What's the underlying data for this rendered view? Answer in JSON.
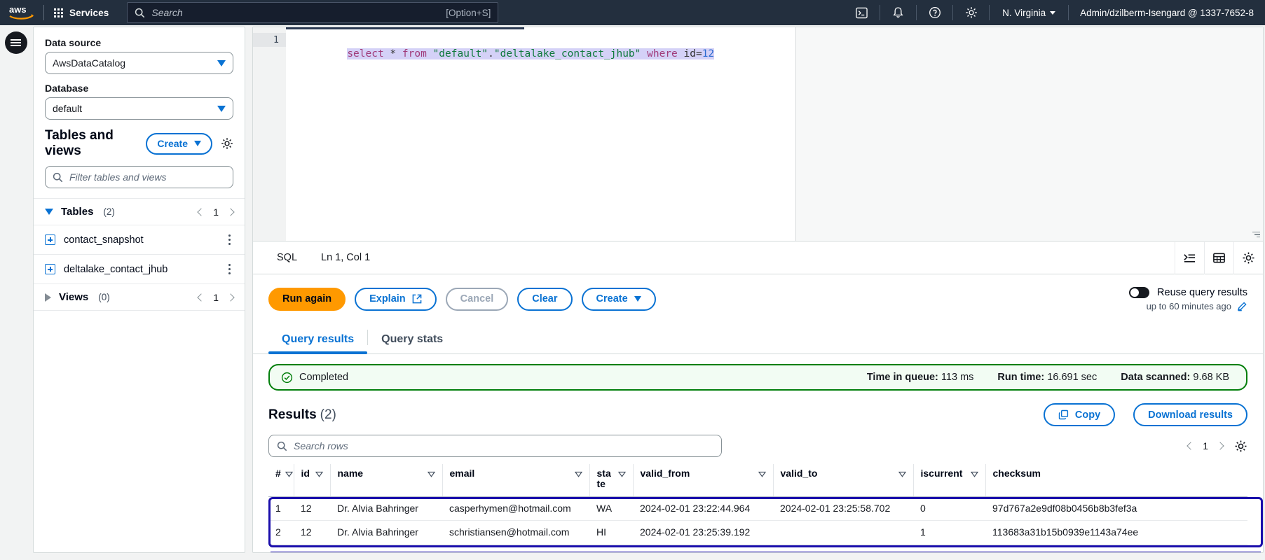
{
  "topnav": {
    "logo_alt": "aws",
    "services_label": "Services",
    "search_placeholder": "Search",
    "search_hint": "[Option+S]",
    "icons": [
      "cloudshell-icon",
      "notifications-icon",
      "help-icon",
      "settings-icon"
    ],
    "region": "N. Virginia",
    "account": "Admin/dzilberm-Isengard @ 1337-7652-8"
  },
  "sidebar": {
    "data_source_label": "Data source",
    "data_source_value": "AwsDataCatalog",
    "database_label": "Database",
    "database_value": "default",
    "tables_views_title": "Tables and views",
    "create_label": "Create",
    "filter_placeholder": "Filter tables and views",
    "groups": [
      {
        "name": "Tables",
        "count": "(2)",
        "page": "1",
        "expanded": true
      },
      {
        "name": "Views",
        "count": "(0)",
        "page": "1",
        "expanded": false
      }
    ],
    "tables": [
      {
        "name": "contact_snapshot"
      },
      {
        "name": "deltalake_contact_jhub"
      }
    ]
  },
  "editor": {
    "line_number": "1",
    "sql_tokens": [
      {
        "text": "select",
        "type": "kw"
      },
      {
        "text": " ",
        "type": "plain"
      },
      {
        "text": "*",
        "type": "op"
      },
      {
        "text": " ",
        "type": "plain"
      },
      {
        "text": "from",
        "type": "kw"
      },
      {
        "text": " ",
        "type": "plain"
      },
      {
        "text": "\"default\"",
        "type": "str"
      },
      {
        "text": ".",
        "type": "op"
      },
      {
        "text": "\"deltalake_contact_jhub\"",
        "type": "str"
      },
      {
        "text": " ",
        "type": "plain"
      },
      {
        "text": "where",
        "type": "kw"
      },
      {
        "text": " ",
        "type": "plain"
      },
      {
        "text": "id",
        "type": "op"
      },
      {
        "text": "=",
        "type": "op"
      },
      {
        "text": "12",
        "type": "num"
      }
    ],
    "sql_plain": "select * from \"default\".\"deltalake_contact_jhub\" where id=12"
  },
  "statusbar": {
    "language": "SQL",
    "cursor": "Ln 1, Col 1",
    "icons": [
      "format-sql-icon",
      "table-preferences-icon",
      "settings-gear-icon"
    ]
  },
  "actions": {
    "run_again": "Run again",
    "explain": "Explain",
    "cancel": "Cancel",
    "clear": "Clear",
    "create": "Create",
    "reuse_label": "Reuse query results",
    "reuse_sub": "up to 60 minutes ago",
    "reuse_enabled": false
  },
  "tabs": [
    {
      "label": "Query results",
      "active": true
    },
    {
      "label": "Query stats",
      "active": false
    }
  ],
  "banner": {
    "status": "Completed",
    "time_in_queue_label": "Time in queue:",
    "time_in_queue_value": "113 ms",
    "run_time_label": "Run time:",
    "run_time_value": "16.691 sec",
    "data_scanned_label": "Data scanned:",
    "data_scanned_value": "9.68 KB",
    "accent": "#037f0c"
  },
  "results": {
    "title": "Results",
    "count": "(2)",
    "copy_label": "Copy",
    "download_label": "Download results",
    "search_placeholder": "Search rows",
    "page": "1",
    "columns": [
      "#",
      "id",
      "name",
      "email",
      "state",
      "valid_from",
      "valid_to",
      "iscurrent",
      "checksum"
    ],
    "rows": [
      {
        "num": "1",
        "id": "12",
        "name": "Dr. Alvia Bahringer",
        "email": "casperhymen@hotmail.com",
        "state": "WA",
        "valid_from": "2024-02-01 23:22:44.964",
        "valid_to": "2024-02-01 23:25:58.702",
        "iscurrent": "0",
        "checksum": "97d767a2e9df08b0456b8b3fef3a"
      },
      {
        "num": "2",
        "id": "12",
        "name": "Dr. Alvia Bahringer",
        "email": "schristiansen@hotmail.com",
        "state": "HI",
        "valid_from": "2024-02-01 23:25:39.192",
        "valid_to": "",
        "iscurrent": "1",
        "checksum": "113683a31b15b0939e1143a74ee"
      }
    ],
    "highlight_color": "#1a0dab"
  }
}
